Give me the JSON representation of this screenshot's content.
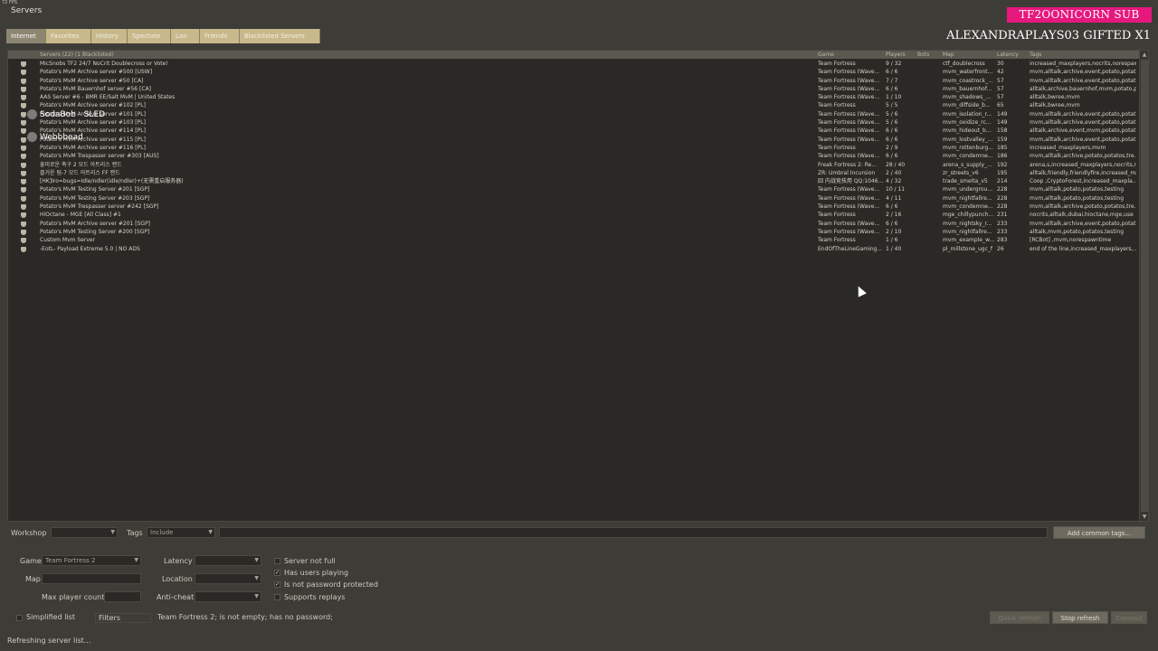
{
  "fps": "72 FPS",
  "window_title": "Servers",
  "tabs": [
    "Internet",
    "Favorites",
    "History",
    "Spectate",
    "Lan",
    "Friends",
    "Blacklisted Servers"
  ],
  "overlay": {
    "sub_badge": "TF2OONICORN SUB",
    "gift_text": "ALEXANDRAPLAYS03  GIFTED X1",
    "chat": [
      "SodaBob",
      "SLED",
      "Webbbead"
    ]
  },
  "list_header": {
    "servers": "Servers (22) (1 Blacklisted)",
    "game": "Game",
    "players": "Players",
    "bots": "Bots",
    "map": "Map",
    "latency": "Latency",
    "tags": "Tags"
  },
  "servers": [
    {
      "name": "MicSnobs TF2 24/7 NoCrit Doublecross or Vote!",
      "game": "Team Fortress",
      "players": "9 / 32",
      "map": "ctf_doublecross",
      "latency": "30",
      "tags": "increased_maxplayers,nocrits,norespawntim..."
    },
    {
      "name": "Potato's MvM Archive server #500 [USW]",
      "game": "Team Fortress (Wave...",
      "players": "6 / 6",
      "map": "mvm_waterfront...",
      "latency": "42",
      "tags": "mvm,alltalk,archive,event,potato,potat..."
    },
    {
      "name": "Potato's MvM Archive server #50 [CA]",
      "game": "Team Fortress (Wave...",
      "players": "7 / 7",
      "map": "mvm_coastrock_...",
      "latency": "57",
      "tags": "mvm,alltalk,archive,event,potato,potat..."
    },
    {
      "name": "Potato's MvM Bauernhof server #56 [CA]",
      "game": "Team Fortress (Wave...",
      "players": "6 / 6",
      "map": "mvm_bauernhof...",
      "latency": "57",
      "tags": "alltalk,archive,bauernhof,mvm,potato,p..."
    },
    {
      "name": "AAS Server #6 - BMR EE/Salt MvM | United States",
      "game": "Team Fortress (Wave...",
      "players": "1 / 10",
      "map": "mvm_shadows_...",
      "latency": "57",
      "tags": "alltalk,bwree,mvm"
    },
    {
      "name": "Potato's MvM Archive server #102 [PL]",
      "game": "Team Fortress",
      "players": "5 / 5",
      "map": "mvm_diffside_b...",
      "latency": "65",
      "tags": "alltalk,bwree,mvm"
    },
    {
      "name": "Potato's MvM Archive server #101 [PL]",
      "game": "Team Fortress (Wave...",
      "players": "5 / 6",
      "map": "mvm_isolation_r...",
      "latency": "149",
      "tags": "mvm,alltalk,archive,event,potato,potat..."
    },
    {
      "name": "Potato's MvM Archive server #103 [PL]",
      "game": "Team Fortress (Wave...",
      "players": "5 / 6",
      "map": "mvm_oxidize_rc...",
      "latency": "149",
      "tags": "mvm,alltalk,archive,event,potato,potat..."
    },
    {
      "name": "Potato's MvM Archive server #114 [PL]",
      "game": "Team Fortress (Wave...",
      "players": "6 / 6",
      "map": "mvm_hideout_b...",
      "latency": "158",
      "tags": "alltalk,archive,event,mvm,potato,potat..."
    },
    {
      "name": "Potato's MvM Archive server #115 [PL]",
      "game": "Team Fortress (Wave...",
      "players": "6 / 6",
      "map": "mvm_lostvalley_...",
      "latency": "159",
      "tags": "mvm,alltalk,archive,event,potato,potat..."
    },
    {
      "name": "Potato's MvM Archive server #116 [PL]",
      "game": "Team Fortress",
      "players": "2 / 9",
      "map": "mvm_rottenburg...",
      "latency": "185",
      "tags": "increased_maxplayers,mvm"
    },
    {
      "name": "Potato's MvM Trespasser server #303 [AUS]",
      "game": "Team Fortress (Wave...",
      "players": "6 / 6",
      "map": "mvm_condemne...",
      "latency": "186",
      "tags": "mvm,alltalk,archive,potato,potatos,tre..."
    },
    {
      "name": "흥미로운 축구 2 모드 아트리스 랜드",
      "game": "Freak Fortress 2: Re...",
      "players": "28 / 40",
      "map": "arena_s_supply_...",
      "latency": "192",
      "tags": "arena,s,increased_maxplayers,nocrits,re..."
    },
    {
      "name": "즐거운 팀-7 모드 아트리스 FF 랜드",
      "game": "ZR: Umbral Incursion",
      "players": "2 / 40",
      "map": "zr_streets_v6",
      "latency": "195",
      "tags": "alltalk,friendly,friendlyfire,increased_ma..."
    },
    {
      "name": "[HK]Iro=bugs=Idle/ndler(idle/ndler)+(无需重启服务器)",
      "game": "囧 内战竞技用 QQ:1046...",
      "players": "4 / 32",
      "map": "trade_smelta_v5",
      "latency": "214",
      "tags": "Coop ,CryptoForest,increased_maxpla..."
    },
    {
      "name": "Potato's MvM Testing Server #201 [SGP]",
      "game": "Team Fortress (Wave...",
      "players": "10 / 11",
      "map": "mvm_undergrou...",
      "latency": "228",
      "tags": "mvm,alltalk,potato,potatos,testing"
    },
    {
      "name": "Potato's MvM Testing Server #203 [SGP]",
      "game": "Team Fortress (Wave...",
      "players": "4 / 11",
      "map": "mvm_nightfallre...",
      "latency": "228",
      "tags": "mvm,alltalk,potato,potatos,testing"
    },
    {
      "name": "Potato's MvM Trespasser server #242 [SGP]",
      "game": "Team Fortress (Wave...",
      "players": "6 / 6",
      "map": "mvm_condemne...",
      "latency": "228",
      "tags": "mvm,alltalk,archive,potato,potatos,tre..."
    },
    {
      "name": "HiOctane - MGE [All Class] #1",
      "game": "Team Fortress",
      "players": "2 / 16",
      "map": "mge_chillypunch...",
      "latency": "231",
      "tags": "nocrits,alltalk,dubai,hioctane,mge,use"
    },
    {
      "name": "Potato's MvM Archive server #201 [SGP]",
      "game": "Team Fortress (Wave...",
      "players": "6 / 6",
      "map": "mvm_nightsky_r...",
      "latency": "233",
      "tags": "mvm,alltalk,archive,event,potato,potat..."
    },
    {
      "name": "Potato's MvM Testing Server #200 [SGP]",
      "game": "Team Fortress (Wave...",
      "players": "2 / 10",
      "map": "mvm_nightfallre...",
      "latency": "233",
      "tags": "alltalk,mvm,potato,potatos,testing"
    },
    {
      "name": "Custom Mvm Server",
      "game": "Team Fortress",
      "players": "1 / 6",
      "map": "mvm_example_w...",
      "latency": "283",
      "tags": "[RCBot] ,mvm,norespawntime"
    },
    {
      "name": "-EotL- Payload Extreme 5.0 | NO ADS",
      "game": "EndOfTheLineGaming...",
      "players": "1 / 40",
      "map": "pl_millstone_ugc_f",
      "latency": "26",
      "tags": "end of the line,increased_maxplayers,..."
    }
  ],
  "filters": {
    "workshop_label": "Workshop",
    "tags_label": "Tags",
    "tags_mode": "Include",
    "add_tags_button": "Add common tags...",
    "game_label": "Game",
    "game_value": "Team Fortress 2",
    "map_label": "Map",
    "max_player_label": "Max player count",
    "latency_label": "Latency",
    "location_label": "Location",
    "anticheat_label": "Anti-cheat",
    "check_not_full": "Server not full",
    "check_has_users": "Has users playing",
    "check_no_password": "Is not password protected",
    "check_replays": "Supports replays",
    "simplified_list": "Simplified list",
    "filters_button": "Filters",
    "filter_summary": "Team Fortress 2; is not empty; has no password;"
  },
  "buttons": {
    "quick_refresh": "Quick refresh",
    "stop_refresh": "Stop refresh",
    "connect": "Connect"
  },
  "status": "Refreshing server list..."
}
